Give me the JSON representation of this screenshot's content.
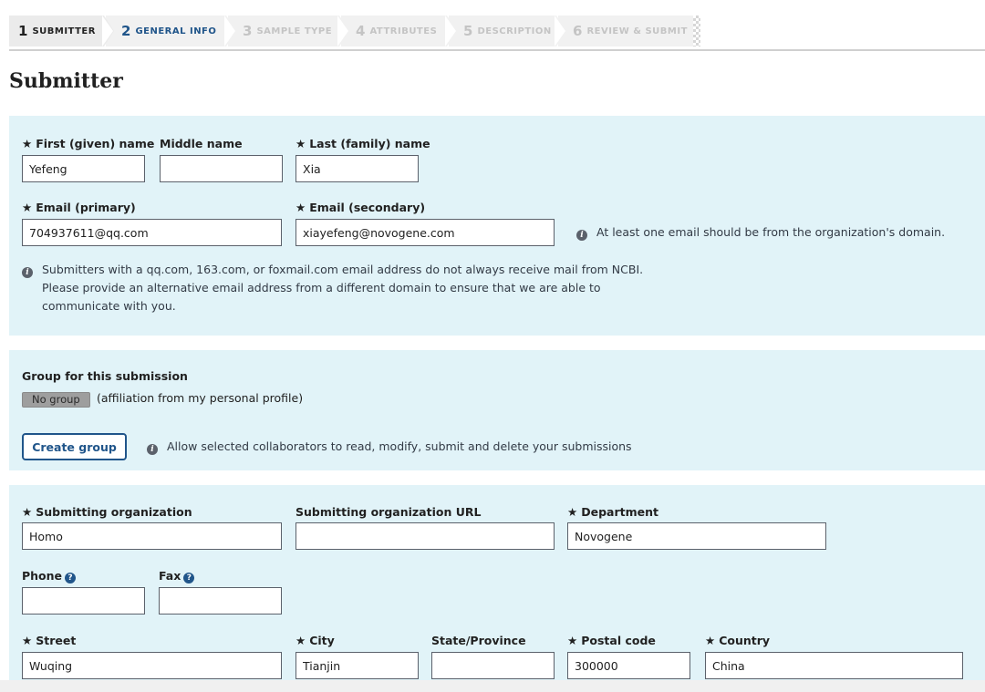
{
  "steps": [
    {
      "num": "1",
      "label": "Submitter",
      "state": "active"
    },
    {
      "num": "2",
      "label": "General info",
      "state": "next"
    },
    {
      "num": "3",
      "label": "Sample type",
      "state": "disabled"
    },
    {
      "num": "4",
      "label": "Attributes",
      "state": "disabled"
    },
    {
      "num": "5",
      "label": "Description",
      "state": "disabled"
    },
    {
      "num": "6",
      "label": "Review & submit",
      "state": "disabled"
    }
  ],
  "page_title": "Submitter",
  "name_section": {
    "first_name_label": "First (given) name",
    "first_name_value": "Yefeng",
    "middle_name_label": "Middle name",
    "middle_name_value": "",
    "last_name_label": "Last (family) name",
    "last_name_value": "Xia",
    "email_primary_label": "Email (primary)",
    "email_primary_value": "704937611@qq.com",
    "email_secondary_label": "Email (secondary)",
    "email_secondary_value": "xiayefeng@novogene.com",
    "email_domain_note": "At least one email should be from the organization's domain.",
    "email_warning_line1": "Submitters with a qq.com, 163.com, or foxmail.com email address do not always receive mail from NCBI.",
    "email_warning_line2": "Please provide an alternative email address from a different domain to ensure that we are able to communicate with you."
  },
  "group_section": {
    "title": "Group for this submission",
    "group_badge": "No group",
    "affiliation_text": "(affiliation from my personal profile)",
    "create_button": "Create group",
    "create_note": "Allow selected collaborators to read, modify, submit and delete your submissions"
  },
  "organization_section": {
    "org_label": "Submitting organization",
    "org_value": "Homo",
    "org_url_label": "Submitting organization URL",
    "org_url_value": "",
    "department_label": "Department",
    "department_value": "Novogene",
    "phone_label": "Phone",
    "phone_value": "",
    "fax_label": "Fax",
    "fax_value": "",
    "street_label": "Street",
    "street_value": "Wuqing",
    "city_label": "City",
    "city_value": "Tianjin",
    "state_label": "State/Province",
    "state_value": "",
    "postal_label": "Postal code",
    "postal_value": "300000",
    "country_label": "Country",
    "country_value": "China"
  },
  "icons": {
    "required": "star-icon",
    "info": "info-icon",
    "help": "question-icon"
  },
  "colors": {
    "panel_bg": "#e1f3f8",
    "link_blue": "#20558a"
  }
}
